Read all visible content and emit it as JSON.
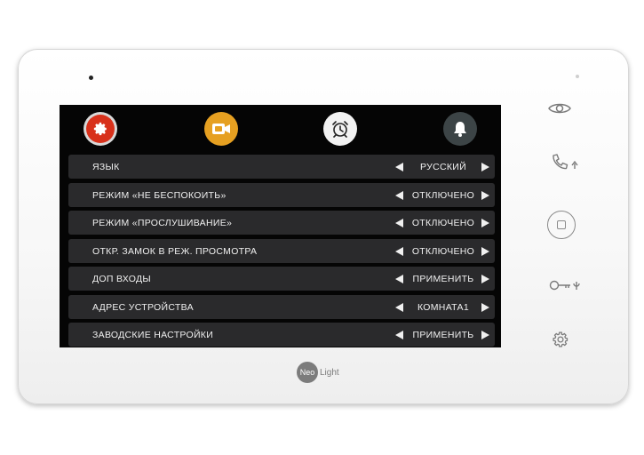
{
  "brand": {
    "badge": "Neo",
    "rest": "Light"
  },
  "tabs": [
    {
      "name": "settings",
      "icon": "gear-icon",
      "color": "#d8311b",
      "active": true
    },
    {
      "name": "video",
      "icon": "video-camera-icon",
      "color": "#e6a021"
    },
    {
      "name": "clock",
      "icon": "alarm-clock-icon",
      "color": "#f2f2f2"
    },
    {
      "name": "bell",
      "icon": "bell-icon",
      "color": "#3c4446"
    }
  ],
  "menu": {
    "items": [
      {
        "label": "ЯЗЫК",
        "value": "РУССКИЙ"
      },
      {
        "label": "РЕЖИМ «НЕ БЕСПОКОИТЬ»",
        "value": "ОТКЛЮЧЕНО"
      },
      {
        "label": "РЕЖИМ «ПРОСЛУШИВАНИЕ»",
        "value": "ОТКЛЮЧЕНО"
      },
      {
        "label": "ОТКР. ЗАМОК В РЕЖ. ПРОСМОТРА",
        "value": "ОТКЛЮЧЕНО"
      },
      {
        "label": "ДОП ВХОДЫ",
        "value": "ПРИМЕНИТЬ"
      },
      {
        "label": "АДРЕС УСТРОЙСТВА",
        "value": "КОМНАТА1"
      },
      {
        "label": "ЗАВОДСКИЕ НАСТРОЙКИ",
        "value": "ПРИМЕНИТЬ"
      }
    ]
  },
  "side_buttons": [
    {
      "name": "monitor",
      "icon": "eye-icon"
    },
    {
      "name": "call",
      "icon": "phone-icon"
    },
    {
      "name": "home",
      "icon": "home-button-icon"
    },
    {
      "name": "unlock",
      "icon": "key-icon"
    },
    {
      "name": "settings",
      "icon": "gear-icon"
    }
  ]
}
